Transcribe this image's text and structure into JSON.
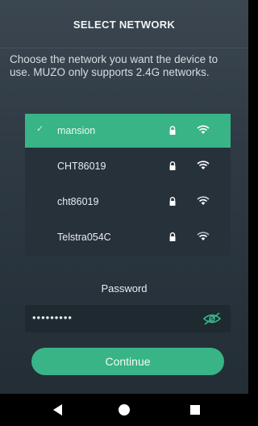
{
  "header": {
    "title": "SELECT NETWORK"
  },
  "instructions": "Choose the network you want the device to use. MUZO only supports 2.4G networks.",
  "networks": [
    {
      "ssid": "mansion",
      "selected": true,
      "secured": true
    },
    {
      "ssid": "CHT86019",
      "selected": false,
      "secured": true
    },
    {
      "ssid": "cht86019",
      "selected": false,
      "secured": true
    },
    {
      "ssid": "Telstra054C",
      "selected": false,
      "secured": true
    }
  ],
  "password": {
    "label": "Password",
    "value": "•••••••••"
  },
  "continue_label": "Continue",
  "icons": {
    "check": "check-icon",
    "lock": "lock-icon",
    "wifi": "wifi-icon",
    "eye": "eye-hidden-icon",
    "back": "back-triangle-icon",
    "home": "home-circle-icon",
    "recents": "recents-square-icon"
  },
  "colors": {
    "accent": "#38b486",
    "background": "#2f3a44",
    "list_background": "#27313a",
    "navbar": "#000000"
  }
}
